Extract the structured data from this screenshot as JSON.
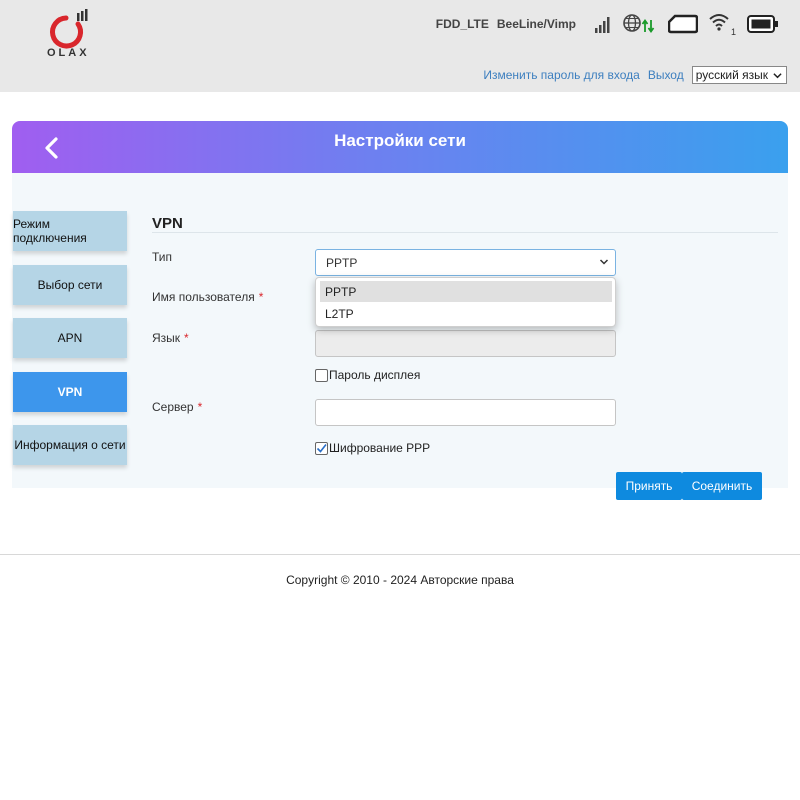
{
  "header": {
    "logo_text": "OLAX",
    "network_mode": "FDD_LTE",
    "operator": "BeeLine/Vimp",
    "wifi_clients": "1",
    "icons": [
      "signal-bars-icon",
      "globe-data-icon",
      "sim-card-icon",
      "wifi-icon",
      "battery-icon"
    ],
    "links": {
      "change_password": "Изменить пароль для входа",
      "logout": "Выход"
    },
    "language": "русский язык"
  },
  "banner": {
    "title": "Настройки сети"
  },
  "sidebar": {
    "items": [
      {
        "label": "Режим подключения",
        "active": false
      },
      {
        "label": "Выбор сети",
        "active": false
      },
      {
        "label": "APN",
        "active": false
      },
      {
        "label": "VPN",
        "active": true
      },
      {
        "label": "Информация о сети",
        "active": false
      }
    ]
  },
  "form": {
    "heading": "VPN",
    "type_label": "Тип",
    "type_value": "PPTP",
    "username_label": "Имя пользователя",
    "password_label": "Язык",
    "show_password_label": "Пароль дисплея",
    "show_password_checked": false,
    "server_label": "Сервер",
    "server_value": "",
    "ppp_encryption_label": "Шифрование PPP",
    "ppp_encryption_checked": true,
    "required_mark": "*",
    "dropdown_options": [
      "PPTP",
      "L2TP"
    ],
    "dropdown_selected": "PPTP"
  },
  "buttons": {
    "apply": "Принять",
    "connect": "Соединить"
  },
  "footer": {
    "copyright": "Copyright © 2010 - 2024 Авторские права"
  },
  "colors": {
    "accent": "#0e8adf",
    "sidebar_active": "#3d96ec",
    "sidebar_inactive": "#b5d5e6",
    "required": "#d9262c",
    "logo_red": "#d9262c",
    "data_green": "#1a9a2a"
  }
}
